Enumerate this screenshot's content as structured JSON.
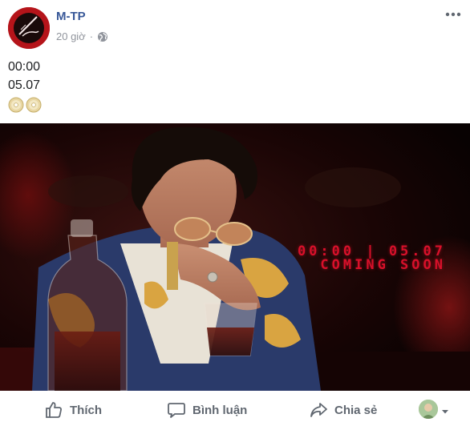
{
  "post": {
    "author": "M-TP",
    "time": "20 giờ",
    "separator": "·",
    "privacy_icon": "globe-icon",
    "text_lines": [
      "00:00",
      "05.07"
    ],
    "emoji_icons": [
      "dvd-disc-icon",
      "dvd-disc-icon"
    ]
  },
  "photo": {
    "overlay_line1": "00:00 | 05.07",
    "overlay_line2": "COMING SOON",
    "overlay_color": "#d8102a"
  },
  "actions": {
    "like_label": "Thích",
    "comment_label": "Bình luận",
    "share_label": "Chia sẻ"
  },
  "colors": {
    "author_link": "#385898",
    "meta_text": "#90949c",
    "action_text": "#606770"
  }
}
